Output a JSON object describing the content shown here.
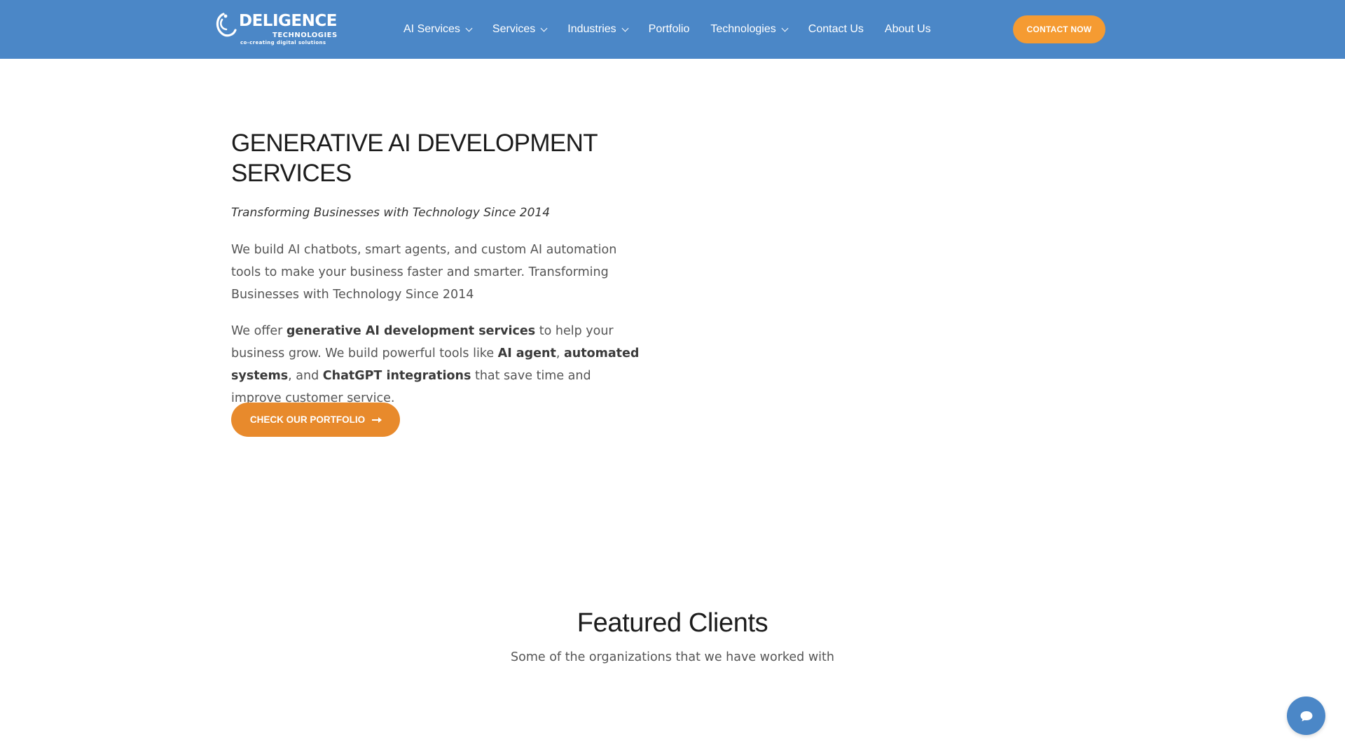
{
  "colors": {
    "header_bg": "#4b87c7",
    "accent_orange": "#f59b32",
    "button_orange": "#e88a2c",
    "chat_blue": "#4b87c7"
  },
  "brand": {
    "name": "DELIGENCE",
    "sub": "TECHNOLOGIES",
    "tagline": "co-creating digital solutions"
  },
  "nav": {
    "items": [
      {
        "label": "AI Services",
        "has_dropdown": true
      },
      {
        "label": "Services",
        "has_dropdown": true
      },
      {
        "label": "Industries",
        "has_dropdown": true
      },
      {
        "label": "Portfolio",
        "has_dropdown": false
      },
      {
        "label": "Technologies",
        "has_dropdown": true
      },
      {
        "label": "Contact Us",
        "has_dropdown": false
      },
      {
        "label": "About Us",
        "has_dropdown": false
      }
    ],
    "cta_label": "CONTACT NOW"
  },
  "hero": {
    "title": "GENERATIVE AI DEVELOPMENT SERVICES",
    "tagline": "Transforming Businesses with Technology Since 2014",
    "paragraph1": "We build AI chatbots, smart agents, and custom AI automation tools to make your business faster and smarter. Transforming Businesses with Technology Since 2014",
    "paragraph2": {
      "t1": "We offer ",
      "b1": "generative AI development services",
      "t2": " to help your business grow. We build powerful tools like ",
      "b2": "AI agent",
      "t3": ", ",
      "b3": "automated systems",
      "t4": ", and ",
      "b4": "ChatGPT integrations",
      "t5": " that save time and improve customer service."
    },
    "button_label": "CHECK OUR PORTFOLIO",
    "button_icon": "arrow-right-icon"
  },
  "clients": {
    "title": "Featured Clients",
    "subtitle": "Some of the organizations that we have worked with"
  },
  "chat": {
    "icon": "chat-bubble-icon"
  }
}
